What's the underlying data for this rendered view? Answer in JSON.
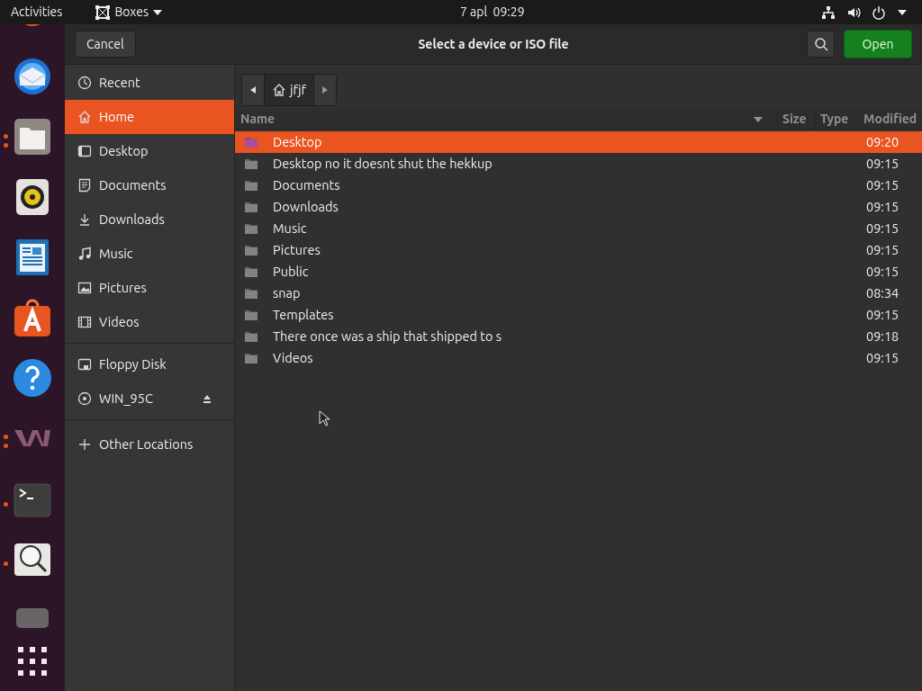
{
  "top_bar": {
    "activities": "Activities",
    "app_menu": "Boxes",
    "clock": "7 apl  09:29"
  },
  "dock": [
    {
      "running": false,
      "multiple": false
    },
    {
      "running": false,
      "multiple": false
    },
    {
      "running": true,
      "multiple": true
    },
    {
      "running": false,
      "multiple": false
    },
    {
      "running": false,
      "multiple": false
    },
    {
      "running": false,
      "multiple": false
    },
    {
      "running": false,
      "multiple": false
    },
    {
      "running": true,
      "multiple": true
    },
    {
      "running": true,
      "multiple": false
    },
    {
      "running": true,
      "multiple": false
    },
    {
      "running": false,
      "multiple": false
    }
  ],
  "dialog": {
    "title": "Select a device or ISO file",
    "cancel": "Cancel",
    "open": "Open"
  },
  "sidebar": {
    "groups": [
      {
        "items": [
          {
            "label": "Recent",
            "selected": false,
            "ejectable": false
          },
          {
            "label": "Home",
            "selected": true,
            "ejectable": false
          },
          {
            "label": "Desktop",
            "selected": false,
            "ejectable": false
          },
          {
            "label": "Documents",
            "selected": false,
            "ejectable": false
          },
          {
            "label": "Downloads",
            "selected": false,
            "ejectable": false
          },
          {
            "label": "Music",
            "selected": false,
            "ejectable": false
          },
          {
            "label": "Pictures",
            "selected": false,
            "ejectable": false
          },
          {
            "label": "Videos",
            "selected": false,
            "ejectable": false
          }
        ]
      },
      {
        "items": [
          {
            "label": "Floppy Disk",
            "selected": false,
            "ejectable": false
          },
          {
            "label": "WIN_95C",
            "selected": false,
            "ejectable": true
          }
        ]
      },
      {
        "items": [
          {
            "label": "Other Locations",
            "selected": false,
            "ejectable": false
          }
        ]
      }
    ]
  },
  "path_bar": {
    "crumbs": [
      "jfjf"
    ]
  },
  "table": {
    "columns": [
      "Name",
      "Size",
      "Type",
      "Modified"
    ],
    "rows": [
      {
        "name": "Desktop",
        "modified": "09:20",
        "selected": true
      },
      {
        "name": "Desktop no it doesnt shut the hekkup",
        "modified": "09:15",
        "selected": false
      },
      {
        "name": "Documents",
        "modified": "09:15",
        "selected": false
      },
      {
        "name": "Downloads",
        "modified": "09:15",
        "selected": false
      },
      {
        "name": "Music",
        "modified": "09:15",
        "selected": false
      },
      {
        "name": "Pictures",
        "modified": "09:15",
        "selected": false
      },
      {
        "name": "Public",
        "modified": "09:15",
        "selected": false
      },
      {
        "name": "snap",
        "modified": "08:34",
        "selected": false
      },
      {
        "name": "Templates",
        "modified": "09:15",
        "selected": false
      },
      {
        "name": "There once was a ship that shipped to s",
        "modified": "09:18",
        "selected": false
      },
      {
        "name": "Videos",
        "modified": "09:15",
        "selected": false
      }
    ]
  }
}
